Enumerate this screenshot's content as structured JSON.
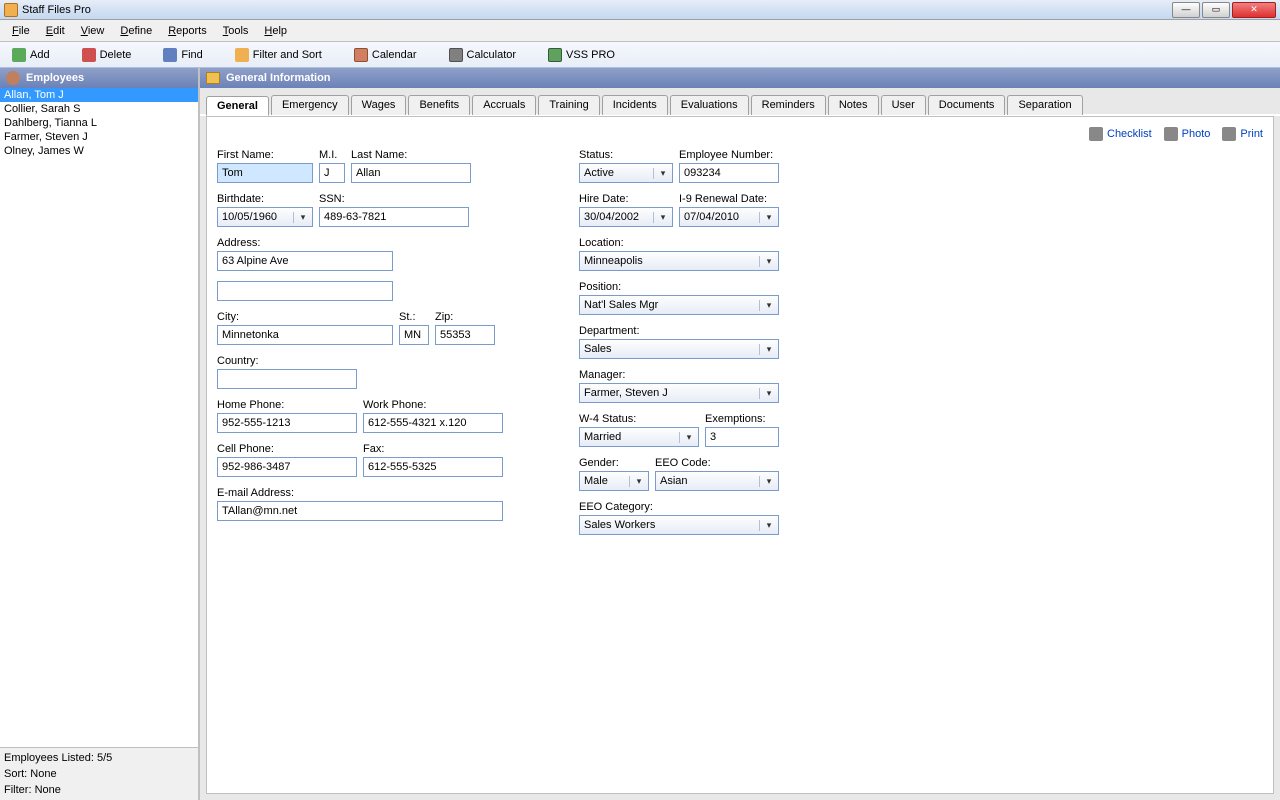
{
  "app": {
    "title": "Staff Files Pro"
  },
  "menu": {
    "file": "File",
    "edit": "Edit",
    "view": "View",
    "define": "Define",
    "reports": "Reports",
    "tools": "Tools",
    "help": "Help"
  },
  "toolbar": {
    "add": "Add",
    "delete": "Delete",
    "find": "Find",
    "filtersort": "Filter and Sort",
    "calendar": "Calendar",
    "calculator": "Calculator",
    "vsspro": "VSS PRO"
  },
  "sidebar": {
    "title": "Employees",
    "items": [
      "Allan, Tom J",
      "Collier, Sarah S",
      "Dahlberg, Tianna L",
      "Farmer, Steven J",
      "Olney, James W"
    ],
    "footer": {
      "listed_label": "Employees Listed:",
      "listed_value": "5/5",
      "sort_label": "Sort:",
      "sort_value": "None",
      "filter_label": "Filter:",
      "filter_value": "None"
    }
  },
  "mainpanel": {
    "title": "General Information"
  },
  "tabs": [
    "General",
    "Emergency",
    "Wages",
    "Benefits",
    "Accruals",
    "Training",
    "Incidents",
    "Evaluations",
    "Reminders",
    "Notes",
    "User",
    "Documents",
    "Separation"
  ],
  "actions": {
    "checklist": "Checklist",
    "photo": "Photo",
    "print": "Print"
  },
  "labels": {
    "first_name": "First Name:",
    "mi": "M.I.",
    "last_name": "Last Name:",
    "birthdate": "Birthdate:",
    "ssn": "SSN:",
    "address": "Address:",
    "city": "City:",
    "st": "St.:",
    "zip": "Zip:",
    "country": "Country:",
    "home_phone": "Home Phone:",
    "work_phone": "Work Phone:",
    "cell_phone": "Cell Phone:",
    "fax": "Fax:",
    "email": "E-mail Address:",
    "status": "Status:",
    "emp_no": "Employee Number:",
    "hire_date": "Hire Date:",
    "i9": "I-9 Renewal Date:",
    "location": "Location:",
    "position": "Position:",
    "department": "Department:",
    "manager": "Manager:",
    "w4": "W-4 Status:",
    "exemptions": "Exemptions:",
    "gender": "Gender:",
    "eeo_code": "EEO Code:",
    "eeo_category": "EEO Category:"
  },
  "values": {
    "first_name": "Tom",
    "mi": "J",
    "last_name": "Allan",
    "birthdate": "10/05/1960",
    "ssn": "489-63-7821",
    "address1": "63 Alpine Ave",
    "address2": "",
    "city": "Minnetonka",
    "st": "MN",
    "zip": "55353",
    "country": "",
    "home_phone": "952-555-1213",
    "work_phone": "612-555-4321 x.120",
    "cell_phone": "952-986-3487",
    "fax": "612-555-5325",
    "email": "TAllan@mn.net",
    "status": "Active",
    "emp_no": "093234",
    "hire_date": "30/04/2002",
    "i9": "07/04/2010",
    "location": "Minneapolis",
    "position": "Nat'l Sales Mgr",
    "department": "Sales",
    "manager": "Farmer, Steven J",
    "w4": "Married",
    "exemptions": "3",
    "gender": "Male",
    "eeo_code": "Asian",
    "eeo_category": "Sales Workers"
  }
}
